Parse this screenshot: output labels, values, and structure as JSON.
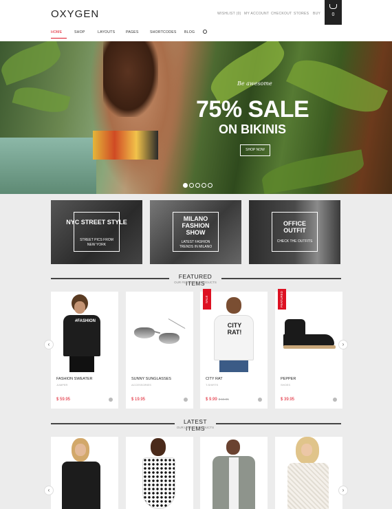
{
  "header": {
    "logo": "OXYGEN",
    "top_links": [
      "WISHLIST (0)",
      "MY ACCOUNT",
      "CHECKOUT",
      "STORES",
      "BUY"
    ],
    "cart_count": "0",
    "cart_icon": "basket-icon"
  },
  "nav": {
    "items": [
      "HOME",
      "SHOP",
      "LAYOUTS",
      "PAGES",
      "SHORTCODES",
      "BLOG"
    ],
    "search_icon": "search-icon",
    "active_color": "#dd1122"
  },
  "hero": {
    "script": "Be awesome",
    "title": "75% SALE",
    "subtitle": "ON BIKINIS",
    "button": "SHOP NOW",
    "slides": 5,
    "active_slide": 1
  },
  "promos": [
    {
      "title": "NYC STREET STYLE",
      "subtitle": "STREET PICS FROM NEW YORK"
    },
    {
      "title": "MILANO FASHION SHOW",
      "subtitle": "LATEST FASHION TRENDS IN MILANO"
    },
    {
      "title": "OFFICE OUTFIT",
      "subtitle": "CHECK THE OUTFITS"
    }
  ],
  "featured": {
    "title": "FEATURED ITEMS",
    "subtitle": "OUR FEATURED PRODUCTS",
    "products": [
      {
        "name": "FASHION SWEATER",
        "category": "JUMPER",
        "price": "$ 59.95",
        "old_price": "",
        "badge": ""
      },
      {
        "name": "SUNNY SUNGLASSES",
        "category": "ACCESSORIES",
        "price": "$ 19.95",
        "old_price": "",
        "badge": ""
      },
      {
        "name": "CITY RAT",
        "category": "T-SHIRTS",
        "price": "$ 9.99",
        "old_price": "$ 15.95",
        "badge": "SALE"
      },
      {
        "name": "PEPPER",
        "category": "SHOES",
        "price": "$ 39.95",
        "old_price": "",
        "badge": "FEATURED"
      }
    ],
    "arrow_left": "‹",
    "arrow_right": "›"
  },
  "latest": {
    "title": "LATEST ITEMS",
    "subtitle": "OUR LATEST PRODUCTS",
    "arrow_left": "‹",
    "arrow_right": "›"
  }
}
